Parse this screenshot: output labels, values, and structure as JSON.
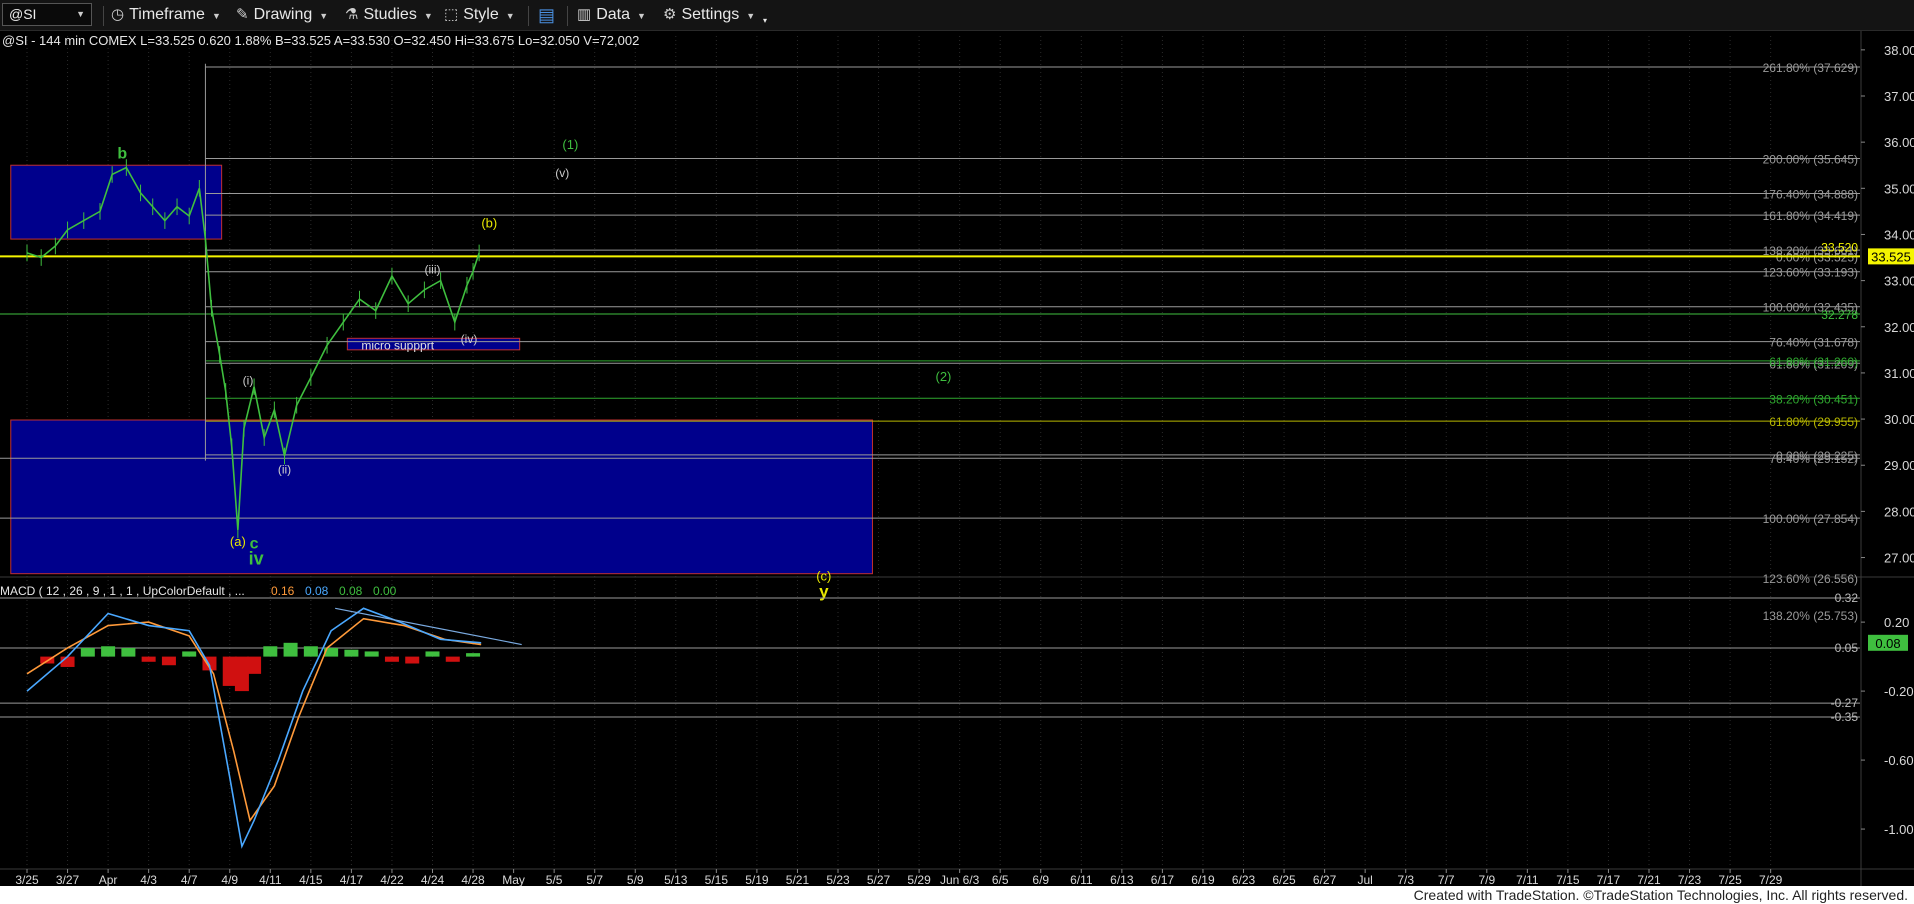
{
  "toolbar": {
    "symbol": "@SI",
    "timeframe": "Timeframe",
    "drawing": "Drawing",
    "studies": "Studies",
    "style": "Style",
    "data": "Data",
    "settings": "Settings"
  },
  "header_line": "@SI - 144 min  COMEX  L=33.525  0.620  1.88%  B=33.525  A=33.530  O=32.450  Hi=33.675  Lo=32.050  V=72,002",
  "footer": "Created with TradeStation. ©TradeStation Technologies, Inc. All rights reserved.",
  "colors": {
    "green": "#3fbf3f",
    "yellow": "#f5f500",
    "blue_box": "#00008c",
    "red_bar": "#d01010",
    "macd_blue": "#4aa8ff",
    "macd_orange": "#ff9a3a"
  },
  "chart_data": [
    {
      "type": "line",
      "instrument": "@SI",
      "x_ticks": [
        "3/25",
        "3/27",
        "Apr",
        "4/3",
        "4/7",
        "4/9",
        "4/11",
        "4/15",
        "4/17",
        "4/22",
        "4/24",
        "4/28",
        "May",
        "5/5",
        "5/7",
        "5/9",
        "5/13",
        "5/15",
        "5/19",
        "5/21",
        "5/23",
        "5/27",
        "5/29",
        "Jun 6/3",
        "6/5",
        "6/9",
        "6/11",
        "6/13",
        "6/17",
        "6/19",
        "6/23",
        "6/25",
        "6/27",
        "Jul",
        "7/3",
        "7/7",
        "7/9",
        "7/11",
        "7/15",
        "7/17",
        "7/21",
        "7/23",
        "7/25",
        "7/29"
      ],
      "ylim": [
        26.6,
        38.3
      ],
      "y_ticks": [
        "38.00",
        "37.00",
        "36.00",
        "35.00",
        "34.00",
        "33.00",
        "32.00",
        "31.00",
        "30.00",
        "29.00",
        "28.00",
        "27.00"
      ],
      "last_price": "33.525",
      "last_price_value": 33.525,
      "price_tag": "33.520",
      "price_series": [
        {
          "x": 0,
          "y": 33.6
        },
        {
          "x": 0.35,
          "y": 33.5
        },
        {
          "x": 0.7,
          "y": 33.75
        },
        {
          "x": 1.0,
          "y": 34.1
        },
        {
          "x": 1.4,
          "y": 34.3
        },
        {
          "x": 1.8,
          "y": 34.5
        },
        {
          "x": 2.1,
          "y": 35.3
        },
        {
          "x": 2.45,
          "y": 35.45
        },
        {
          "x": 2.8,
          "y": 34.9
        },
        {
          "x": 3.1,
          "y": 34.6
        },
        {
          "x": 3.4,
          "y": 34.3
        },
        {
          "x": 3.7,
          "y": 34.6
        },
        {
          "x": 4.0,
          "y": 34.4
        },
        {
          "x": 4.25,
          "y": 35.0
        },
        {
          "x": 4.4,
          "y": 33.9
        },
        {
          "x": 4.55,
          "y": 32.4
        },
        {
          "x": 4.75,
          "y": 31.4
        },
        {
          "x": 4.9,
          "y": 30.6
        },
        {
          "x": 5.05,
          "y": 29.4
        },
        {
          "x": 5.2,
          "y": 27.6
        },
        {
          "x": 5.35,
          "y": 29.8
        },
        {
          "x": 5.6,
          "y": 30.7
        },
        {
          "x": 5.85,
          "y": 29.6
        },
        {
          "x": 6.1,
          "y": 30.2
        },
        {
          "x": 6.35,
          "y": 29.2
        },
        {
          "x": 6.65,
          "y": 30.3
        },
        {
          "x": 7.0,
          "y": 30.9
        },
        {
          "x": 7.4,
          "y": 31.6
        },
        {
          "x": 7.8,
          "y": 32.1
        },
        {
          "x": 8.2,
          "y": 32.6
        },
        {
          "x": 8.6,
          "y": 32.35
        },
        {
          "x": 9.0,
          "y": 33.1
        },
        {
          "x": 9.4,
          "y": 32.5
        },
        {
          "x": 9.8,
          "y": 32.8
        },
        {
          "x": 10.2,
          "y": 33.0
        },
        {
          "x": 10.55,
          "y": 32.1
        },
        {
          "x": 10.85,
          "y": 32.9
        },
        {
          "x": 11.0,
          "y": 33.2
        },
        {
          "x": 11.15,
          "y": 33.6
        }
      ],
      "boxes": [
        {
          "x0": -0.4,
          "x1": 4.8,
          "y0": 33.9,
          "y1": 35.5,
          "label": ""
        },
        {
          "x0": -0.4,
          "x1": 20.85,
          "y0": 26.65,
          "y1": 29.98,
          "label": ""
        },
        {
          "x0": 7.9,
          "x1": 12.15,
          "y0": 31.5,
          "y1": 31.75,
          "label": "micro suppprt"
        }
      ],
      "fib_levels": [
        {
          "label": "261.80% (37.629)",
          "value": 37.629,
          "color": "#9a9a9a",
          "from_x": 4.4
        },
        {
          "label": "200.00% (35.645)",
          "value": 35.645,
          "color": "#9a9a9a",
          "from_x": 4.4
        },
        {
          "label": "176.40% (34.888)",
          "value": 34.888,
          "color": "#9a9a9a",
          "from_x": 4.4
        },
        {
          "label": "161.80% (34.419)",
          "value": 34.419,
          "color": "#9a9a9a",
          "from_x": 4.4
        },
        {
          "label": "138.20% (33.661)",
          "value": 33.661,
          "color": "#9a9a9a",
          "from_x": 4.4
        },
        {
          "label": "0.00% (33.525)",
          "value": 33.525,
          "color": "#9a9a9a",
          "from_x": 4.4
        },
        {
          "label": "123.60% (33.193)",
          "value": 33.193,
          "color": "#9a9a9a",
          "from_x": 4.4
        },
        {
          "label": "100.00% (32.435)",
          "value": 32.435,
          "color": "#9a9a9a",
          "from_x": 4.4
        },
        {
          "label": "32.278",
          "value": 32.278,
          "color": "#3fbf3f",
          "from_x": -1
        },
        {
          "label": "76.40% (31.678)",
          "value": 31.678,
          "color": "#9a9a9a",
          "from_x": 4.4
        },
        {
          "label": "61.80% (31.209)",
          "value": 31.209,
          "color": "#9a9a9a",
          "from_x": 4.4
        },
        {
          "label": "61.80% (31.260)",
          "value": 31.26,
          "color": "#2fa82f",
          "from_x": 4.4
        },
        {
          "label": "38.20% (30.451)",
          "value": 30.451,
          "color": "#2fa82f",
          "from_x": 4.4
        },
        {
          "label": "61.80% (29.955)",
          "value": 29.955,
          "color": "#b8b800",
          "from_x": 4.4
        },
        {
          "label": "0.00% (29.225)",
          "value": 29.225,
          "color": "#9a9a9a",
          "from_x": 4.4
        },
        {
          "label": "76.40% (29.152)",
          "value": 29.152,
          "color": "#9a9a9a",
          "from_x": -1
        },
        {
          "label": "100.00% (27.854)",
          "value": 27.854,
          "color": "#9a9a9a",
          "from_x": -1
        },
        {
          "label": "123.60% (26.556)",
          "value": 26.556,
          "color": "#9a9a9a",
          "from_x": -1
        },
        {
          "label": "138.20% (25.753)",
          "value": 25.753,
          "color": "#9a9a9a",
          "from_x": -1
        }
      ],
      "wave_labels": [
        {
          "text": "b",
          "x": 2.35,
          "y": 35.65,
          "color": "#3fbf3f",
          "size": 16
        },
        {
          "text": "(1)",
          "x": 13.4,
          "y": 35.85,
          "color": "#3fbf3f",
          "size": 13
        },
        {
          "text": "(v)",
          "x": 13.2,
          "y": 35.25,
          "color": "#cccccc",
          "size": 12
        },
        {
          "text": "(b)",
          "x": 11.4,
          "y": 34.15,
          "color": "#e8e800",
          "size": 13
        },
        {
          "text": "(iii)",
          "x": 10.0,
          "y": 33.15,
          "color": "#cccccc",
          "size": 12
        },
        {
          "text": "(iv)",
          "x": 10.9,
          "y": 31.65,
          "color": "#cccccc",
          "size": 12
        },
        {
          "text": "(2)",
          "x": 22.6,
          "y": 30.82,
          "color": "#3fbf3f",
          "size": 13
        },
        {
          "text": "(i)",
          "x": 5.45,
          "y": 30.75,
          "color": "#cccccc",
          "size": 12
        },
        {
          "text": "(ii)",
          "x": 6.35,
          "y": 28.82,
          "color": "#cccccc",
          "size": 12
        },
        {
          "text": "(a)",
          "x": 5.2,
          "y": 27.25,
          "color": "#e8e800",
          "size": 13
        },
        {
          "text": "c",
          "x": 5.6,
          "y": 27.2,
          "color": "#3fbf3f",
          "size": 16
        },
        {
          "text": "iv",
          "x": 5.65,
          "y": 26.85,
          "color": "#3fbf3f",
          "size": 18
        },
        {
          "text": "(c)",
          "x": 19.65,
          "y": 26.5,
          "color": "#e8e800",
          "size": 13
        },
        {
          "text": "y",
          "x": 19.65,
          "y": 26.15,
          "color": "#e8e800",
          "size": 17
        }
      ]
    },
    {
      "type": "line",
      "title": "MACD ( 12 , 26 , 9 , 1 , 1 , UpColorDefault , ...",
      "readouts": [
        "0.16",
        "0.08",
        "0.08",
        "0.00"
      ],
      "readout_colors": [
        "#ff9a3a",
        "#4aa8ff",
        "#3fbf3f",
        "#3fbf3f"
      ],
      "ylim": [
        -1.22,
        0.45
      ],
      "y_ticks": [
        "0.20",
        "-0.20",
        "-0.60",
        "-1.00"
      ],
      "level_labels": [
        {
          "text": "0.32",
          "value": 0.34
        },
        {
          "text": "0.05",
          "value": 0.05
        },
        {
          "text": "-0.27",
          "value": -0.27
        },
        {
          "text": "-0.35",
          "value": -0.35
        }
      ],
      "current_tag": "0.08",
      "current_value": 0.08,
      "macd": [
        {
          "x": 0,
          "y": -0.2
        },
        {
          "x": 1,
          "y": 0.0
        },
        {
          "x": 2,
          "y": 0.25
        },
        {
          "x": 3,
          "y": 0.18
        },
        {
          "x": 4,
          "y": 0.15
        },
        {
          "x": 4.5,
          "y": -0.05
        },
        {
          "x": 5,
          "y": -0.7
        },
        {
          "x": 5.3,
          "y": -1.1
        },
        {
          "x": 5.6,
          "y": -0.95
        },
        {
          "x": 6.2,
          "y": -0.6
        },
        {
          "x": 6.8,
          "y": -0.2
        },
        {
          "x": 7.5,
          "y": 0.15
        },
        {
          "x": 8.3,
          "y": 0.28
        },
        {
          "x": 9.2,
          "y": 0.2
        },
        {
          "x": 10.2,
          "y": 0.1
        },
        {
          "x": 11.2,
          "y": 0.08
        }
      ],
      "signal": [
        {
          "x": 0,
          "y": -0.1
        },
        {
          "x": 1,
          "y": 0.05
        },
        {
          "x": 2,
          "y": 0.18
        },
        {
          "x": 3,
          "y": 0.2
        },
        {
          "x": 4,
          "y": 0.12
        },
        {
          "x": 4.6,
          "y": -0.1
        },
        {
          "x": 5.1,
          "y": -0.55
        },
        {
          "x": 5.5,
          "y": -0.95
        },
        {
          "x": 6.1,
          "y": -0.75
        },
        {
          "x": 6.7,
          "y": -0.35
        },
        {
          "x": 7.4,
          "y": 0.05
        },
        {
          "x": 8.3,
          "y": 0.22
        },
        {
          "x": 9.3,
          "y": 0.18
        },
        {
          "x": 10.3,
          "y": 0.1
        },
        {
          "x": 11.2,
          "y": 0.07
        }
      ],
      "histogram": [
        {
          "x": 0.5,
          "y": -0.04
        },
        {
          "x": 1.0,
          "y": -0.06
        },
        {
          "x": 1.5,
          "y": 0.05
        },
        {
          "x": 2.0,
          "y": 0.06
        },
        {
          "x": 2.5,
          "y": 0.05
        },
        {
          "x": 3.0,
          "y": -0.03
        },
        {
          "x": 3.5,
          "y": -0.05
        },
        {
          "x": 4.0,
          "y": 0.03
        },
        {
          "x": 4.5,
          "y": -0.08
        },
        {
          "x": 5.0,
          "y": -0.17
        },
        {
          "x": 5.3,
          "y": -0.2
        },
        {
          "x": 5.6,
          "y": -0.1
        },
        {
          "x": 6.0,
          "y": 0.06
        },
        {
          "x": 6.5,
          "y": 0.08
        },
        {
          "x": 7.0,
          "y": 0.06
        },
        {
          "x": 7.5,
          "y": 0.05
        },
        {
          "x": 8.0,
          "y": 0.04
        },
        {
          "x": 8.5,
          "y": 0.03
        },
        {
          "x": 9.0,
          "y": -0.03
        },
        {
          "x": 9.5,
          "y": -0.04
        },
        {
          "x": 10.0,
          "y": 0.03
        },
        {
          "x": 10.5,
          "y": -0.03
        },
        {
          "x": 11.0,
          "y": 0.02
        }
      ],
      "trendline": [
        {
          "x": 7.6,
          "y": 0.28
        },
        {
          "x": 12.2,
          "y": 0.07
        }
      ]
    }
  ]
}
